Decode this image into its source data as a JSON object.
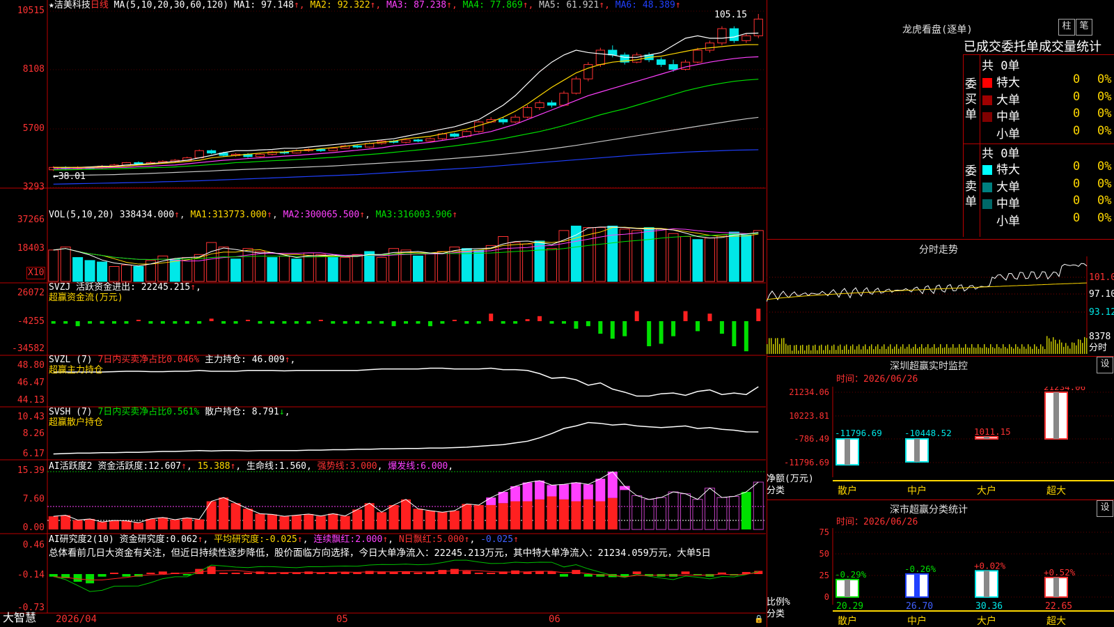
{
  "main": {
    "stock_label": "★洁美科技",
    "period": "日线",
    "ma_label": "MA(5,10,20,30,60,120)",
    "ma_values": [
      {
        "name": "MA1",
        "value": "97.148",
        "arrow": "↑",
        "color": "#ffffff"
      },
      {
        "name": "MA2",
        "value": "92.322",
        "arrow": "↑",
        "color": "#ffd800"
      },
      {
        "name": "MA3",
        "value": "87.238",
        "arrow": "↑",
        "color": "#ff40ff"
      },
      {
        "name": "MA4",
        "value": "77.869",
        "arrow": "↑",
        "color": "#00e000"
      },
      {
        "name": "MA5",
        "value": "61.921",
        "arrow": "↑",
        "color": "#c8c8c8"
      },
      {
        "name": "MA6",
        "value": "48.389",
        "arrow": "↑",
        "color": "#2040ff"
      }
    ],
    "high_marker": "105.15",
    "low_marker": "←38.01",
    "vol": {
      "label": "VOL(5,10,20)",
      "value": "338434.000",
      "ma1": "313773.000",
      "ma2": "300065.500",
      "ma3": "316003.906",
      "unit": "X10"
    },
    "svzj": {
      "label": "SVZJ",
      "text1": "活跃资金进出:",
      "value": "22245.215",
      "text2": "超赢资金流(万元)"
    },
    "svzl": {
      "label": "SVZL (7)",
      "ratio_text": "7日内买卖净占比0.046%",
      "main_text": "主力持仓:",
      "value": "46.009",
      "sub": "超赢主力持仓"
    },
    "svsh": {
      "label": "SVSH (7)",
      "ratio_text": "7日内买卖净占比0.561%",
      "main_text": "散户持仓:",
      "value": "8.791",
      "sub": "超赢散户持仓"
    },
    "ai2": {
      "label": "AI活跃度2",
      "t1": "资金活跃度:",
      "v1": "12.607",
      "v2": "15.388",
      "t3": "生命线:",
      "v3": "1.560",
      "t4": "强势线:",
      "v4": "3.000",
      "t5": "爆发线:",
      "v5": "6.000"
    },
    "ai_research": {
      "label": "AI研究度2(10)",
      "t1": "资金研究度:",
      "v1": "0.062",
      "t2": "平均研究度:",
      "v2": "-0.025",
      "t3": "连续飘红:",
      "v3": "2.000",
      "t4": "N日飘红:",
      "v4": "5.000",
      "v5": "-0.025"
    },
    "summary_text": "总体看前几日大资金有关注，但近日持续性逐步降低，股价面临方向选择，今日大单净流入：22245.213万元，其中特大单净流入：21234.059万元，大单5日",
    "bottom_logo": "大智慧",
    "x_ticks": [
      "2026/04",
      "05",
      "06"
    ]
  },
  "y_ticks": {
    "price": [
      "10515",
      "8108",
      "5700",
      "3293"
    ],
    "vol": [
      "37266",
      "18403"
    ],
    "svzj": [
      "26072",
      "-4255",
      "-34582"
    ],
    "svzl": [
      "48.80",
      "46.47",
      "44.13"
    ],
    "svsh": [
      "10.43",
      "8.26",
      "6.17"
    ],
    "ai2": [
      "15.39",
      "7.60",
      "0.00"
    ],
    "air": [
      "0.46",
      "-0.14",
      "-0.73"
    ]
  },
  "chart_data": {
    "type": "candlestick",
    "price_ylim": [
      32.93,
      105.15
    ],
    "ma_series": [
      {
        "name": "MA1",
        "values": [
          41,
          41,
          41,
          41.2,
          41.5,
          41.5,
          42,
          42.3,
          42.6,
          43,
          43.5,
          44,
          45,
          46,
          47.2,
          48,
          48,
          48.3,
          48.5,
          49,
          49,
          49.5,
          50,
          50.5,
          51,
          51.5,
          52,
          52.5,
          53,
          54,
          55,
          56,
          57,
          58,
          59.5,
          61,
          64,
          67,
          71,
          76,
          81,
          85,
          88,
          90,
          89,
          88.5,
          88,
          87,
          87,
          88,
          89,
          92,
          95,
          96,
          95,
          95,
          95.5,
          97,
          97.148
        ]
      },
      {
        "name": "MA2",
        "values": [
          41,
          41,
          41,
          41,
          41.2,
          41.3,
          41.5,
          42,
          42.3,
          42.7,
          43,
          43.5,
          44,
          45,
          45.5,
          46,
          46.5,
          47,
          47.3,
          47.5,
          48,
          48.3,
          48.8,
          49.3,
          49.8,
          50.5,
          51,
          51.5,
          52,
          53,
          53.5,
          54,
          55,
          56,
          57,
          58.5,
          60,
          62,
          64.5,
          67.5,
          71,
          74.5,
          77.5,
          80.5,
          82.5,
          84,
          85,
          85.5,
          86,
          87,
          87.5,
          88.5,
          89.5,
          90.5,
          91,
          91.5,
          92,
          92.3,
          92.322
        ]
      },
      {
        "name": "MA3",
        "values": [
          40.5,
          40.5,
          40.6,
          40.7,
          40.8,
          41,
          41,
          41.3,
          41.5,
          41.8,
          42,
          42.5,
          43,
          43.5,
          44,
          44.3,
          44.7,
          45,
          45.3,
          45.7,
          46,
          46.4,
          46.8,
          47.2,
          47.7,
          48.2,
          48.7,
          49.2,
          50,
          50.5,
          51,
          51.5,
          52.3,
          53,
          54,
          55,
          56,
          57.5,
          59,
          61,
          63,
          65,
          67,
          69,
          71,
          72.5,
          74,
          75.5,
          77,
          78.5,
          80,
          81.5,
          83,
          84,
          85,
          85.8,
          86.5,
          87,
          87.238
        ]
      },
      {
        "name": "MA4",
        "values": [
          40,
          40,
          40.1,
          40.2,
          40.3,
          40.4,
          40.5,
          40.7,
          40.9,
          41,
          41.2,
          41.5,
          41.8,
          42.2,
          42.5,
          43,
          43.2,
          43.5,
          43.8,
          44,
          44.3,
          44.6,
          44.9,
          45.2,
          45.6,
          46,
          46.4,
          46.8,
          47.3,
          47.8,
          48.3,
          48.8,
          49.4,
          50,
          50.7,
          51.4,
          52.2,
          53,
          54,
          55,
          56,
          57.2,
          58.5,
          60,
          61.5,
          63,
          64.3,
          65.5,
          67,
          68.5,
          70,
          71.5,
          73,
          74.2,
          75.3,
          76.2,
          77,
          77.5,
          77.869
        ]
      },
      {
        "name": "MA5",
        "values": [
          37.5,
          37.6,
          37.7,
          37.8,
          37.9,
          38,
          38.2,
          38.3,
          38.5,
          38.7,
          38.9,
          39.1,
          39.3,
          39.5,
          39.8,
          40,
          40.2,
          40.4,
          40.6,
          40.8,
          41,
          41.2,
          41.4,
          41.6,
          41.9,
          42.2,
          42.5,
          42.8,
          43.1,
          43.4,
          43.7,
          44,
          44.4,
          44.8,
          45.2,
          45.6,
          46,
          46.5,
          47,
          47.6,
          48.2,
          48.8,
          49.5,
          50.2,
          51,
          51.8,
          52.6,
          53.4,
          54.2,
          55,
          55.8,
          56.6,
          57.4,
          58.2,
          59,
          59.8,
          60.6,
          61.3,
          61.921
        ]
      },
      {
        "name": "MA6",
        "values": [
          34,
          34.1,
          34.2,
          34.3,
          34.4,
          34.5,
          34.6,
          34.7,
          34.8,
          35,
          35.1,
          35.3,
          35.4,
          35.6,
          35.8,
          36,
          36.2,
          36.4,
          36.6,
          36.8,
          37,
          37.2,
          37.4,
          37.6,
          37.8,
          38,
          38.3,
          38.6,
          38.9,
          39.2,
          39.5,
          39.8,
          40.1,
          40.4,
          40.7,
          41,
          41.4,
          41.8,
          42.2,
          42.6,
          43,
          43.4,
          43.8,
          44.2,
          44.6,
          45,
          45.4,
          45.8,
          46.2,
          46.5,
          46.8,
          47.1,
          47.4,
          47.6,
          47.8,
          48,
          48.2,
          48.3,
          48.389
        ]
      }
    ],
    "candles": [
      [
        40,
        41,
        39.5,
        41.5
      ],
      [
        41,
        40.5,
        40,
        41.5
      ],
      [
        40.5,
        41,
        40,
        41.5
      ],
      [
        41,
        40.8,
        40.3,
        41.3
      ],
      [
        40.8,
        41.5,
        40.5,
        42
      ],
      [
        41.5,
        42,
        41,
        42.5
      ],
      [
        42,
        43,
        41.8,
        43.2
      ],
      [
        43,
        42.5,
        42,
        43.5
      ],
      [
        42.5,
        43,
        42.2,
        43.5
      ],
      [
        43,
        43.5,
        42.8,
        44
      ],
      [
        43.5,
        44,
        43,
        44.5
      ],
      [
        44,
        45,
        43.8,
        45.5
      ],
      [
        45,
        48,
        44.8,
        48.5
      ],
      [
        48,
        47,
        46.5,
        48.5
      ],
      [
        47,
        46,
        45.5,
        47.5
      ],
      [
        46,
        46.5,
        45.5,
        47
      ],
      [
        46.5,
        45.5,
        45,
        47
      ],
      [
        45.5,
        46.5,
        45.2,
        47
      ],
      [
        46.5,
        47.5,
        46,
        48
      ],
      [
        47.5,
        47,
        46.5,
        48
      ],
      [
        47,
        48,
        46.8,
        48.5
      ],
      [
        48,
        48.5,
        47.5,
        49
      ],
      [
        48.5,
        48,
        47.5,
        49
      ],
      [
        48,
        49,
        47.8,
        49.5
      ],
      [
        49,
        50,
        48.8,
        50.5
      ],
      [
        50,
        49.5,
        49,
        50.5
      ],
      [
        49.5,
        51,
        49.2,
        51.5
      ],
      [
        51,
        52,
        50.5,
        52.5
      ],
      [
        52,
        51.5,
        51,
        52.5
      ],
      [
        51.5,
        52.5,
        51,
        53
      ],
      [
        52.5,
        52,
        51.5,
        53
      ],
      [
        52,
        53,
        51.8,
        53.5
      ],
      [
        53,
        55,
        52.5,
        55.5
      ],
      [
        55,
        54,
        53.5,
        55.5
      ],
      [
        54,
        56,
        53.5,
        56.5
      ],
      [
        56,
        60,
        55.5,
        60.5
      ],
      [
        60,
        61,
        59.5,
        62
      ],
      [
        61,
        60,
        59,
        62
      ],
      [
        60,
        62,
        59.5,
        63
      ],
      [
        62,
        66,
        61.5,
        67
      ],
      [
        66,
        68,
        65,
        69
      ],
      [
        68,
        67,
        66,
        69
      ],
      [
        67,
        72,
        66.5,
        73
      ],
      [
        72,
        78,
        71.5,
        79
      ],
      [
        78,
        84,
        77,
        85
      ],
      [
        84,
        90,
        83,
        91
      ],
      [
        90,
        88,
        87,
        92
      ],
      [
        88,
        85,
        84,
        89
      ],
      [
        85,
        88,
        84.5,
        89
      ],
      [
        88,
        86,
        85,
        89
      ],
      [
        86,
        84,
        83,
        87
      ],
      [
        84,
        82,
        81,
        86
      ],
      [
        82,
        85,
        81.5,
        86
      ],
      [
        85,
        90,
        84.5,
        91
      ],
      [
        90,
        93,
        89,
        94
      ],
      [
        93,
        99,
        92,
        100
      ],
      [
        99,
        94,
        93,
        100
      ],
      [
        94,
        96,
        93,
        97
      ],
      [
        96,
        103,
        95,
        105.15
      ]
    ],
    "volume_values": [
      21,
      23,
      16,
      14,
      13,
      10,
      11,
      10,
      14,
      17,
      15,
      16,
      18,
      26,
      23,
      15,
      22,
      20,
      16,
      17,
      15,
      19,
      18,
      16,
      16,
      18,
      20,
      16,
      22,
      21,
      17,
      19,
      20,
      23,
      22,
      21,
      24,
      30,
      26,
      25,
      27,
      22,
      34,
      37,
      36,
      36,
      37,
      35,
      34,
      36,
      35,
      32,
      30,
      28,
      29,
      31,
      33,
      31,
      34
    ],
    "volume_colors": [
      "r",
      "r",
      "c",
      "c",
      "c",
      "r",
      "r",
      "c",
      "r",
      "r",
      "c",
      "r",
      "r",
      "r",
      "r",
      "c",
      "r",
      "r",
      "c",
      "r",
      "c",
      "r",
      "r",
      "c",
      "r",
      "r",
      "c",
      "r",
      "r",
      "r",
      "c",
      "r",
      "r",
      "r",
      "c",
      "c",
      "r",
      "r",
      "r",
      "r",
      "c",
      "r",
      "r",
      "c",
      "r",
      "r",
      "c",
      "r",
      "r",
      "c",
      "r",
      "r",
      "r",
      "c",
      "r",
      "r",
      "c",
      "c",
      "r"
    ],
    "svzj_values": [
      -1,
      -1,
      -2,
      -1,
      -1,
      -1,
      -1,
      0.5,
      -1,
      -1,
      -1,
      -1,
      -1,
      1,
      -1,
      -1,
      0.5,
      -1,
      -1,
      -1,
      -1,
      -1,
      0.5,
      -1,
      -1,
      -1,
      -1,
      -1,
      -2,
      -1,
      -1,
      -2,
      -1,
      0.5,
      -1,
      -1,
      3,
      -1,
      -1,
      0.8,
      2,
      -1,
      -1,
      -3,
      -2,
      -5,
      -7,
      -6,
      4,
      -10,
      -9,
      -6,
      4,
      -4,
      3,
      -5,
      -10,
      -12,
      5
    ],
    "svzl_values": [
      47.9,
      47.9,
      47.9,
      47.9,
      47.9,
      47.95,
      48,
      48,
      47.95,
      47.95,
      48,
      48,
      48.1,
      48,
      48,
      48,
      48.1,
      48.1,
      48.1,
      48.05,
      48.1,
      48.1,
      48.1,
      48.1,
      48.1,
      48.1,
      48.2,
      48.3,
      48.3,
      48.3,
      48.3,
      48.4,
      48.4,
      48.3,
      48.3,
      48.3,
      48.4,
      48.2,
      48.2,
      48.1,
      47.7,
      47.1,
      47.2,
      46.9,
      46.2,
      46.5,
      45.7,
      45.3,
      44.8,
      44.8,
      45.1,
      45.2,
      44.9,
      45.4,
      45.6,
      45.0,
      45.2,
      45.0,
      46.009
    ],
    "svsh_values": [
      6.2,
      6.25,
      6.3,
      6.3,
      6.35,
      6.35,
      6.4,
      6.4,
      6.45,
      6.5,
      6.5,
      6.55,
      6.6,
      6.55,
      6.6,
      6.6,
      6.55,
      6.6,
      6.6,
      6.6,
      6.6,
      6.65,
      6.65,
      6.7,
      6.7,
      6.75,
      6.75,
      6.8,
      6.8,
      6.85,
      6.85,
      6.9,
      6.9,
      6.95,
      7.0,
      7.1,
      7.2,
      7.3,
      7.5,
      7.7,
      8.1,
      8.6,
      9.2,
      9.5,
      9.9,
      9.8,
      9.6,
      9.7,
      9.5,
      9.4,
      9.3,
      9.4,
      9.5,
      9.2,
      9.3,
      9.1,
      9.0,
      8.8,
      8.791
    ],
    "ai2_values": [
      3.5,
      3.8,
      2.5,
      2.8,
      2.0,
      2.4,
      2.3,
      1.8,
      2.8,
      3.2,
      2.6,
      3.1,
      2.7,
      7.5,
      8.5,
      7.0,
      5.5,
      4.2,
      4.0,
      3.5,
      3.8,
      4.1,
      3.6,
      4.2,
      3.6,
      5.3,
      7.0,
      4.6,
      6.5,
      8.0,
      5.5,
      5.0,
      4.6,
      5.0,
      6.8,
      6.5,
      8.5,
      10.0,
      11.5,
      12.5,
      13.0,
      11.8,
      12.0,
      12.5,
      12.0,
      13.5,
      15.388,
      11.5,
      9.0,
      8.0,
      8.5,
      10.0,
      9.5,
      8.0,
      11.0,
      8.5,
      8.8,
      10.0,
      12.607
    ],
    "ai2_magenta": [
      0,
      0,
      0,
      0,
      0,
      0,
      0,
      0,
      0,
      0,
      0,
      0,
      0,
      0,
      0,
      0,
      0,
      0,
      0,
      0,
      0,
      0,
      0,
      0,
      0,
      0,
      0,
      0,
      0,
      0,
      0,
      0,
      0,
      0,
      0,
      0,
      2,
      3,
      4,
      5,
      5,
      3,
      4,
      5,
      4,
      6,
      7,
      1,
      0,
      0,
      0,
      0,
      0,
      0,
      0,
      0,
      0,
      0,
      0
    ],
    "air_values": [
      -0.05,
      -0.08,
      -0.15,
      -0.18,
      -0.05,
      0.02,
      -0.05,
      -0.05,
      0.02,
      0.05,
      0.02,
      -0.01,
      0.1,
      0.15,
      0.02,
      0.01,
      0.02,
      0.05,
      0.03,
      0.02,
      0.02,
      0.05,
      0.03,
      0.04,
      0.04,
      0.03,
      0.06,
      0.05,
      0.04,
      0.05,
      0.03,
      0.05,
      0.08,
      0.1,
      0.06,
      0.02,
      0.02,
      0.05,
      0.07,
      0.04,
      0.06,
      0.05,
      -0.05,
      0.08,
      -0.05,
      -0.05,
      -0.06,
      -0.05,
      0.05,
      -0.04,
      -0.05,
      -0.05,
      0.05,
      -0.03,
      -0.05,
      0.03,
      -0.02,
      0.04,
      0.062
    ]
  },
  "right": {
    "dragon_title": "龙虎看盘(逐单)",
    "btn_zhu": "柱",
    "btn_bi": "笔",
    "stats_title": "已成交委托单成交量统计",
    "buy_side": "委买单",
    "sell_side": "委卖单",
    "total": "共 0单",
    "rows": [
      {
        "name": "特大",
        "count": "0",
        "pct": "0%"
      },
      {
        "name": "大单",
        "count": "0",
        "pct": "0%"
      },
      {
        "name": "中单",
        "count": "0",
        "pct": "0%"
      },
      {
        "name": "小单",
        "count": "0",
        "pct": "0%"
      }
    ],
    "intraday_title": "分时走势",
    "intraday_y": [
      "101.0",
      "97.10",
      "93.12"
    ],
    "intraday_vol": "8378",
    "intraday_unit": "分时",
    "monitor_title": "深圳超赢实时监控",
    "settings": "设",
    "time_label": "时间：2026/06/26",
    "monitor_y": [
      "21234.06",
      "10223.81",
      "-786.49",
      "-11796.69"
    ],
    "monitor_bars": [
      {
        "cat": "散户",
        "value": "-11796.69"
      },
      {
        "cat": "中户",
        "value": "-10448.52"
      },
      {
        "cat": "大户",
        "value": "1011.15"
      },
      {
        "cat": "超大",
        "value": "21234.06"
      }
    ],
    "monitor_axis_label": "净额(万元)",
    "monitor_axis_cat": "分类",
    "class_title": "深市超赢分类统计",
    "class_y": [
      "75",
      "50",
      "25",
      "0"
    ],
    "class_bars": [
      {
        "cat": "散户",
        "value": "20.29",
        "change": "-0.29%"
      },
      {
        "cat": "中户",
        "value": "26.70",
        "change": "-0.26%"
      },
      {
        "cat": "大户",
        "value": "30.36",
        "change": "+0.02%"
      },
      {
        "cat": "超大",
        "value": "22.65",
        "change": "+0.52%"
      }
    ],
    "class_axis_label": "比例%",
    "class_axis_cat": "分类"
  }
}
